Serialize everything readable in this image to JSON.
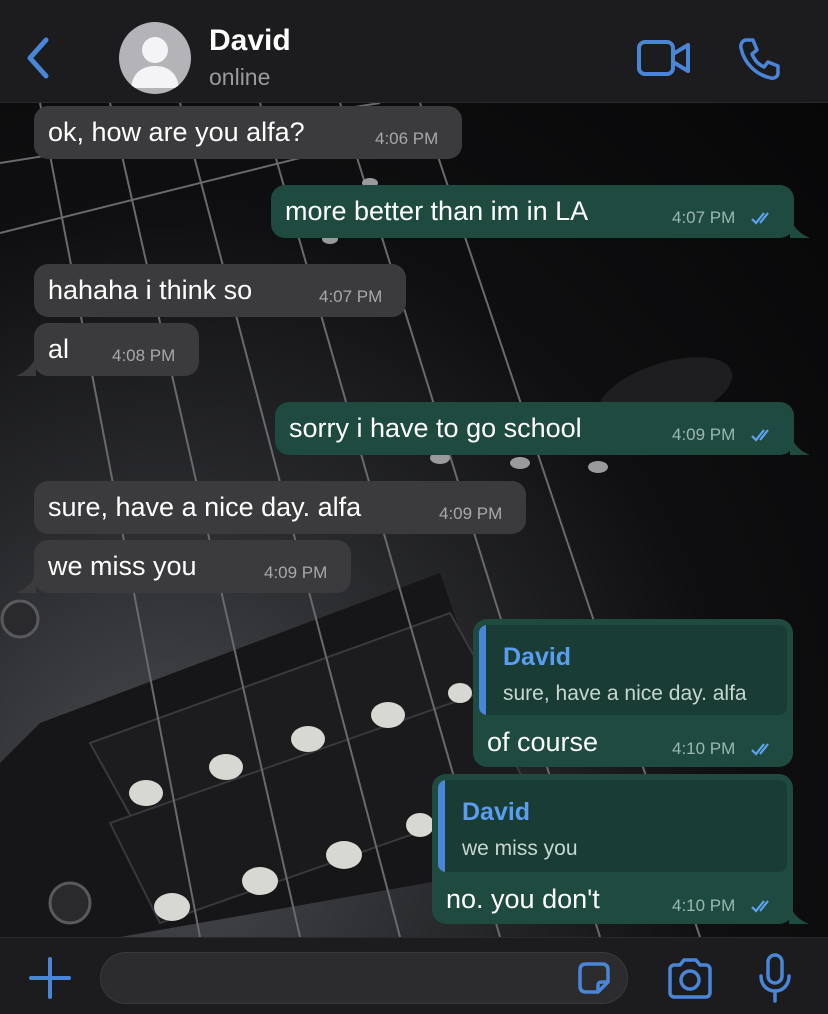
{
  "contact": {
    "name": "David",
    "status": "online"
  },
  "messages": [
    {
      "dir": "in",
      "text": "ok, how are you alfa?",
      "time": "4:06 PM"
    },
    {
      "dir": "out",
      "text": "more better than im in LA",
      "time": "4:07 PM",
      "read": true
    },
    {
      "dir": "in",
      "text": "hahaha i think so",
      "time": "4:07 PM"
    },
    {
      "dir": "in",
      "text": "al",
      "time": "4:08 PM"
    },
    {
      "dir": "out",
      "text": "sorry i have to go school",
      "time": "4:09 PM",
      "read": true
    },
    {
      "dir": "in",
      "text": "sure, have a nice day. alfa",
      "time": "4:09 PM"
    },
    {
      "dir": "in",
      "text": "we miss you",
      "time": "4:09 PM"
    },
    {
      "dir": "out",
      "text": "of course",
      "time": "4:10 PM",
      "read": true,
      "reply": {
        "name": "David",
        "text": "sure, have a nice day. alfa"
      }
    },
    {
      "dir": "out",
      "text": "no. you don't",
      "time": "4:10 PM",
      "read": true,
      "reply": {
        "name": "David",
        "text": "we miss you"
      }
    }
  ],
  "composer": {
    "placeholder": ""
  },
  "icons": {
    "back": "chevron-left-icon",
    "avatar": "person-icon",
    "video": "video-camera-icon",
    "call": "phone-icon",
    "plus": "plus-icon",
    "sticker": "sticker-icon",
    "camera": "camera-icon",
    "mic": "microphone-icon",
    "read": "double-check-icon"
  },
  "colors": {
    "accent": "#4a86d8",
    "incoming": "#3b3b3d",
    "outgoing": "#1f4a40",
    "bar": "#1c1c1e"
  }
}
